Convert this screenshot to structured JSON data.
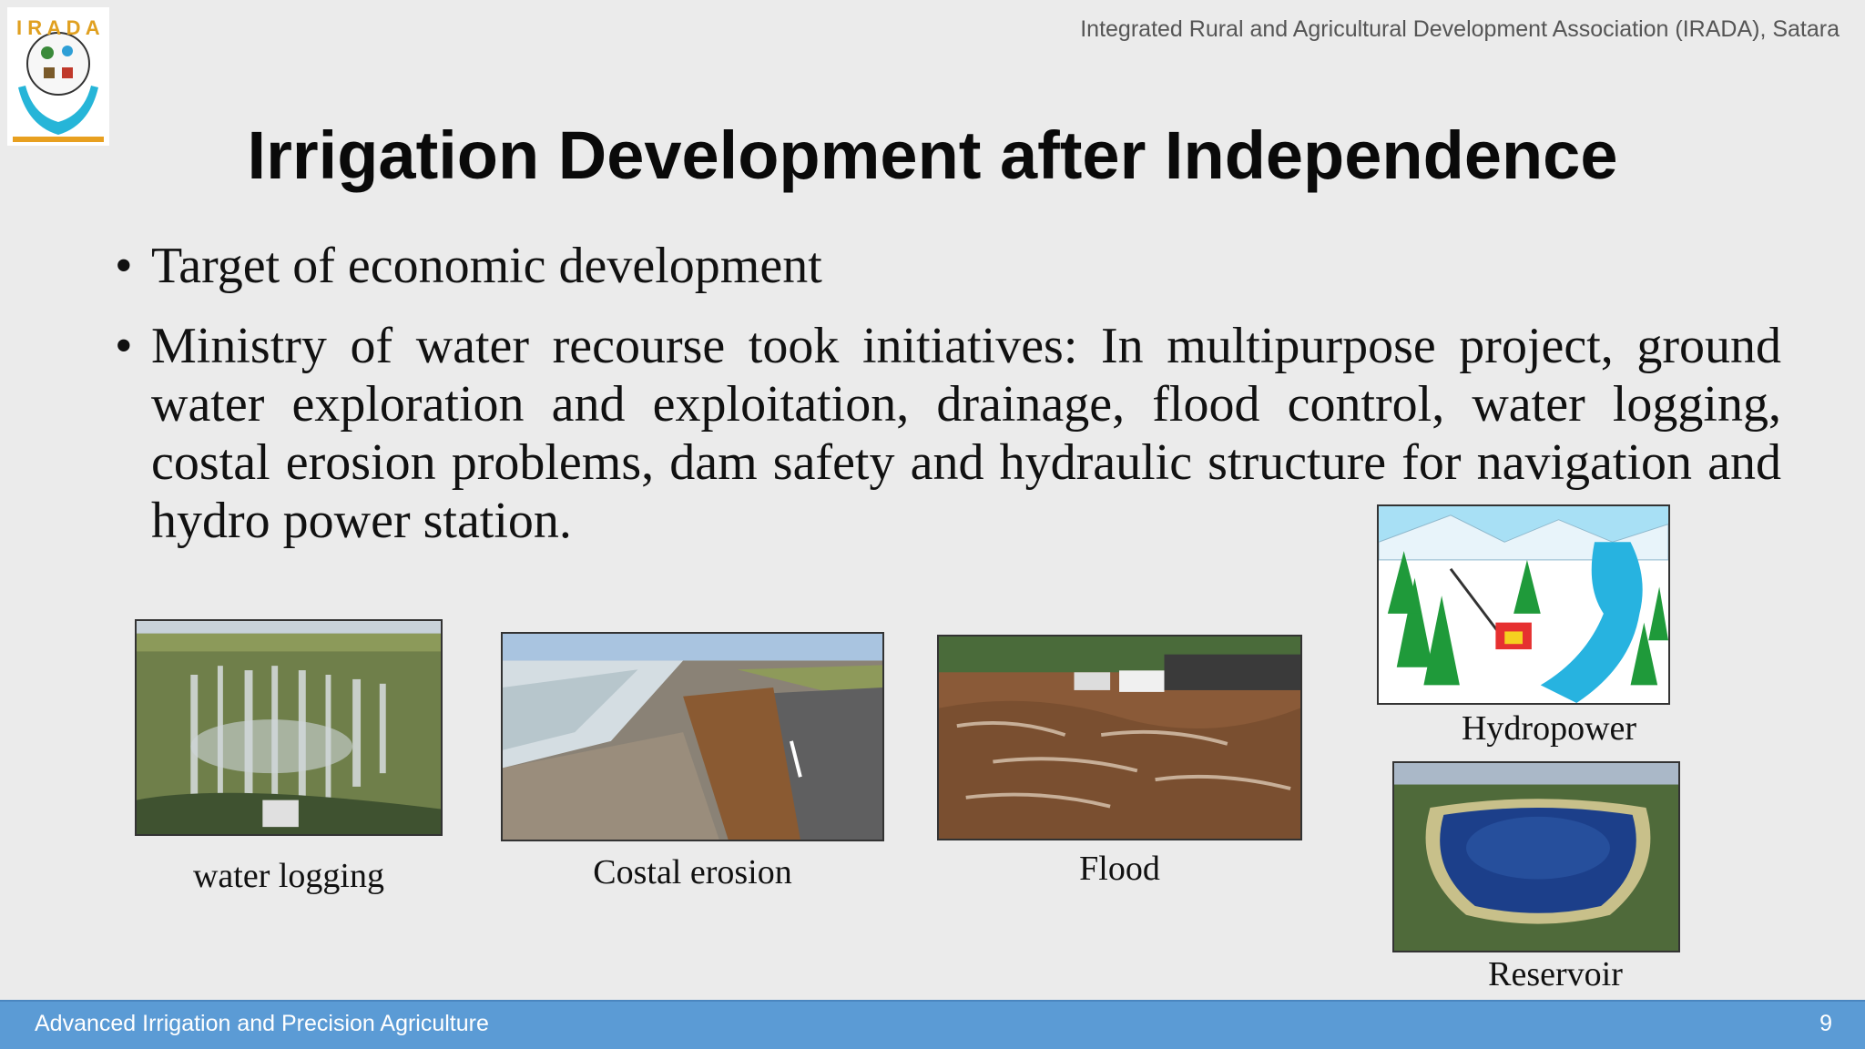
{
  "header": {
    "org_name": "Integrated Rural and Agricultural Development Association (IRADA), Satara",
    "logo_icon": "irada-logo-icon"
  },
  "slide": {
    "title": "Irrigation Development after Independence",
    "bullets": [
      "Target of economic development",
      "Ministry of water recourse took initiatives: In multipurpose project, ground water exploration and exploitation, drainage, flood control, water logging, costal erosion problems, dam safety and hydraulic structure for navigation and hydro power station."
    ],
    "bullet_symbol": "•"
  },
  "images": {
    "water_logging": {
      "caption": "water logging",
      "icon": "waterlogged-field-image"
    },
    "costal_erosion": {
      "caption": "Costal erosion",
      "icon": "coastal-erosion-image"
    },
    "flood": {
      "caption": "Flood",
      "icon": "flooded-street-image"
    },
    "hydropower": {
      "caption": "Hydropower",
      "icon": "hydropower-diagram-image"
    },
    "reservoir": {
      "caption": "Reservoir",
      "icon": "reservoir-aerial-image"
    }
  },
  "footer": {
    "course": "Advanced Irrigation and Precision Agriculture",
    "page_number": "9"
  },
  "colors": {
    "background": "#ebebeb",
    "footer_bar": "#5b9bd5",
    "title": "#0a0a0a"
  }
}
